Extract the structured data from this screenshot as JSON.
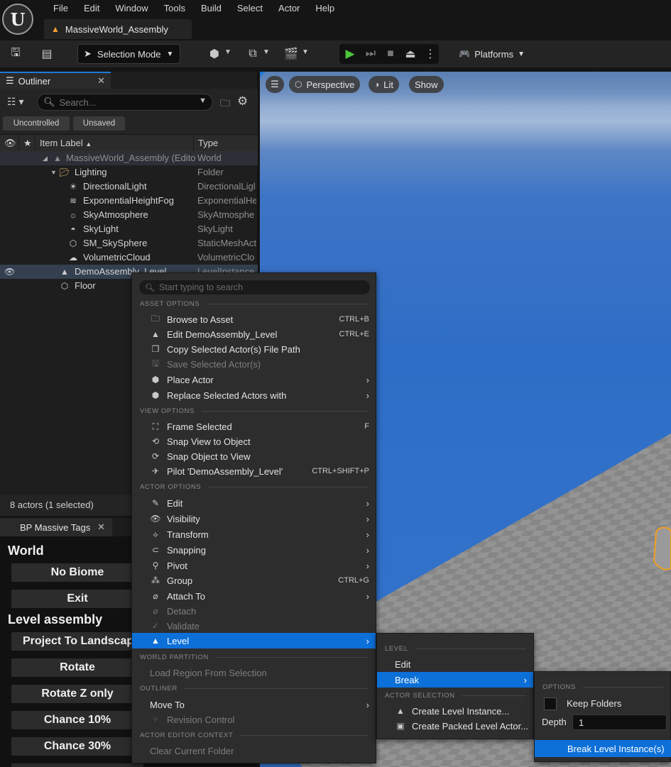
{
  "menubar": {
    "items": [
      "File",
      "Edit",
      "Window",
      "Tools",
      "Build",
      "Select",
      "Actor",
      "Help"
    ],
    "level_tab": "MassiveWorld_Assembly"
  },
  "toolbar": {
    "selection_mode": "Selection Mode",
    "platforms": "Platforms"
  },
  "outliner": {
    "tab": "Outliner",
    "search_placeholder": "Search...",
    "filters": [
      "Uncontrolled",
      "Unsaved"
    ],
    "columns": {
      "label": "Item Label",
      "type": "Type"
    },
    "rows": [
      {
        "label": "MassiveWorld_Assembly (Edito",
        "type": "World"
      },
      {
        "label": "Lighting",
        "type": "Folder"
      },
      {
        "label": "DirectionalLight",
        "type": "DirectionalLigl"
      },
      {
        "label": "ExponentialHeightFog",
        "type": "ExponentialHe"
      },
      {
        "label": "SkyAtmosphere",
        "type": "SkyAtmosphe"
      },
      {
        "label": "SkyLight",
        "type": "SkyLight"
      },
      {
        "label": "SM_SkySphere",
        "type": "StaticMeshAct"
      },
      {
        "label": "VolumetricCloud",
        "type": "VolumetricClo"
      },
      {
        "label": "DemoAssembly_Level",
        "type": "LevelInstance"
      },
      {
        "label": "Floor",
        "type": ""
      }
    ],
    "status": "8 actors (1 selected)"
  },
  "bp_panel": {
    "tab": "BP Massive Tags",
    "header_world": "World",
    "btn_no_biome": "No Biome",
    "btn_exit": "Exit",
    "header_level_assembly": "Level assembly",
    "btn_project": "Project To Landscape",
    "btn_rotate": "Rotate",
    "btn_rotate_z": "Rotate Z only",
    "btn_chance10": "Chance 10%",
    "btn_chance30": "Chance 30%"
  },
  "viewport": {
    "perspective": "Perspective",
    "lit": "Lit",
    "show": "Show"
  },
  "context_menu": {
    "search_placeholder": "Start typing to search",
    "sections": {
      "asset": "ASSET OPTIONS",
      "view": "VIEW OPTIONS",
      "actor": "ACTOR OPTIONS",
      "world_partition": "WORLD PARTITION",
      "outliner": "OUTLINER",
      "actor_editor": "ACTOR EDITOR CONTEXT"
    },
    "items": {
      "browse": {
        "label": "Browse to Asset",
        "shortcut": "CTRL+B"
      },
      "edit_level": {
        "label": "Edit DemoAssembly_Level",
        "shortcut": "CTRL+E"
      },
      "copy_path": {
        "label": "Copy Selected Actor(s) File Path"
      },
      "save_selected": {
        "label": "Save Selected Actor(s)"
      },
      "place_actor": {
        "label": "Place Actor"
      },
      "replace": {
        "label": "Replace Selected Actors with"
      },
      "frame": {
        "label": "Frame Selected",
        "shortcut": "F"
      },
      "snap_view": {
        "label": "Snap View to Object"
      },
      "snap_object": {
        "label": "Snap Object to View"
      },
      "pilot": {
        "label": "Pilot 'DemoAssembly_Level'",
        "shortcut": "CTRL+SHIFT+P"
      },
      "edit": {
        "label": "Edit"
      },
      "visibility": {
        "label": "Visibility"
      },
      "transform": {
        "label": "Transform"
      },
      "snapping": {
        "label": "Snapping"
      },
      "pivot": {
        "label": "Pivot"
      },
      "group": {
        "label": "Group",
        "shortcut": "CTRL+G"
      },
      "attach": {
        "label": "Attach To"
      },
      "detach": {
        "label": "Detach"
      },
      "validate": {
        "label": "Validate"
      },
      "level": {
        "label": "Level"
      },
      "load_region": {
        "label": "Load Region From Selection"
      },
      "move_to": {
        "label": "Move To"
      },
      "revision": {
        "label": "Revision Control"
      },
      "clear_folder": {
        "label": "Clear Current Folder"
      }
    }
  },
  "level_menu": {
    "section_level": "LEVEL",
    "edit": "Edit",
    "break": "Break",
    "section_actor_selection": "ACTOR SELECTION",
    "create_instance": "Create Level Instance...",
    "create_packed": "Create Packed Level Actor..."
  },
  "break_menu": {
    "section_options": "OPTIONS",
    "keep_folders": "Keep Folders",
    "depth_label": "Depth",
    "depth_value": "1",
    "break_button": "Break Level Instance(s)"
  }
}
